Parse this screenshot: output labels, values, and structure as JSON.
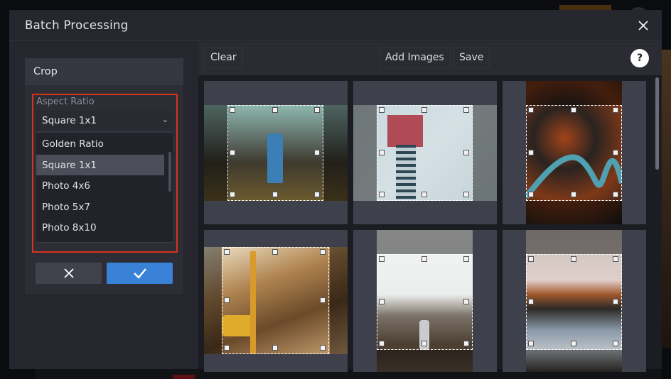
{
  "dialog": {
    "title": "Batch Processing",
    "close_icon": "close-icon"
  },
  "left_panel": {
    "section_title": "Crop",
    "aspect_ratio": {
      "label": "Aspect Ratio",
      "selected": "Square 1x1",
      "options": [
        "Golden Ratio",
        "Square 1x1",
        "Photo 4x6",
        "Photo 5x7",
        "Photo 8x10"
      ],
      "highlight_color": "#d8331f"
    },
    "cancel_icon": "x-icon",
    "confirm_icon": "checkmark-icon",
    "confirm_color": "#3a82d8"
  },
  "toolbar": {
    "clear_label": "Clear",
    "add_images_label": "Add Images",
    "save_label": "Save",
    "help_label": "?"
  },
  "images": [
    {
      "subject": "woman in blue dress in greenhouse",
      "orientation": "landscape"
    },
    {
      "subject": "roller coaster against sky",
      "orientation": "landscape"
    },
    {
      "subject": "aerial winding river through autumn forest",
      "orientation": "portrait"
    },
    {
      "subject": "city street with yellow taxi",
      "orientation": "landscape"
    },
    {
      "subject": "person on hill overlooking foggy town",
      "orientation": "portrait"
    },
    {
      "subject": "misty lake with autumn trees",
      "orientation": "portrait"
    }
  ]
}
